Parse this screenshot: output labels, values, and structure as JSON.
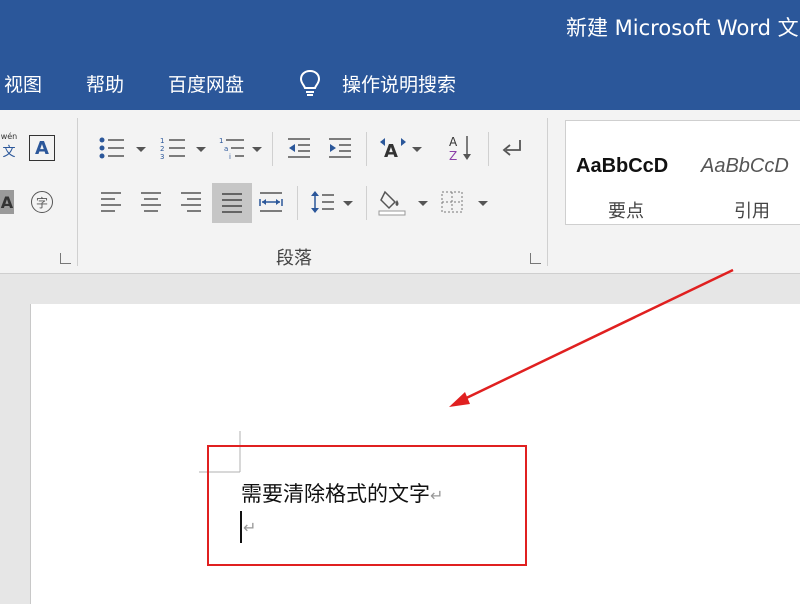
{
  "title": "新建 Microsoft Word 文",
  "menu": [
    "视图",
    "帮助",
    "百度网盘",
    "操作说明搜索"
  ],
  "pinyin_glyph_top": "wén",
  "pinyin_glyph_bottom": "文",
  "font_glyph": "A",
  "enclose_glyph": "字",
  "sort_glyph": "A",
  "sort_glyph2": "Z",
  "paragraph_group_label": "段落",
  "styles": [
    {
      "sample": "AaBbCcD",
      "name": "要点"
    },
    {
      "sample": "AaBbCcD",
      "name": "引用"
    }
  ],
  "document": {
    "line1": "需要清除格式的文字",
    "para_mark": "↵"
  },
  "colors": {
    "accent": "#2b579a",
    "annotation": "#e02020"
  }
}
